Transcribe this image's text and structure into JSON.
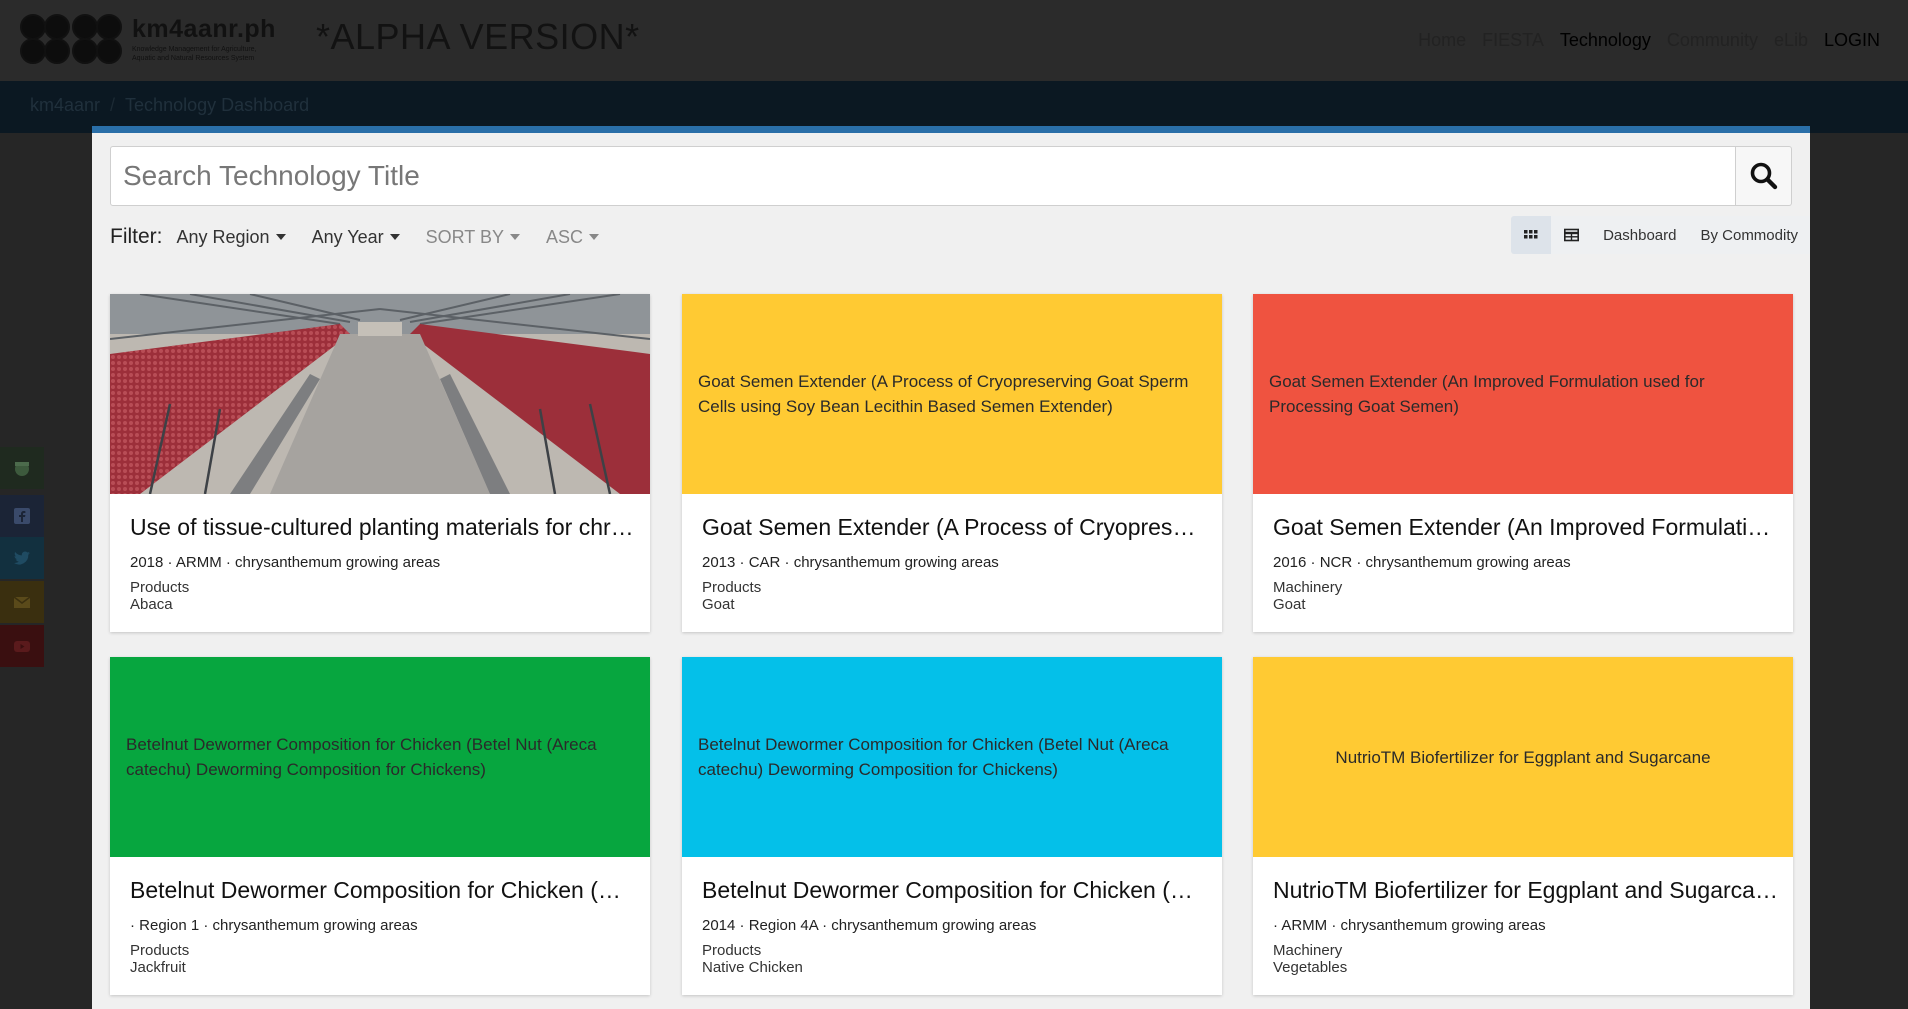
{
  "header": {
    "logo_name": "km4aanr.ph",
    "logo_sub": "Knowledge Management for Agriculture,\nAquatic and Natural Resources System",
    "alpha": "*ALPHA VERSION*",
    "nav": [
      "Home",
      "FIESTA",
      "Technology",
      "Community",
      "eLib",
      "LOGIN"
    ]
  },
  "breadcrumb": {
    "root": "km4aanr",
    "sep": "/",
    "current": "Technology Dashboard"
  },
  "search": {
    "placeholder": "Search Technology Title"
  },
  "filter": {
    "label": "Filter:",
    "region": "Any Region",
    "year": "Any Year",
    "sort": "SORT BY",
    "order": "ASC"
  },
  "views": {
    "dashboard": "Dashboard",
    "commodity": "By Commodity"
  },
  "colors": {
    "yellow": "#ffca33",
    "red": "#ef5340",
    "green": "#07a63f",
    "cyan": "#04c0e9",
    "accent": "#2a6fa8"
  },
  "cards": [
    {
      "cover_text": "",
      "title": "Use of tissue-cultured planting materials for chrysanthemum",
      "meta": "2018 · ARMM · chrysanthemum growing areas",
      "type": "Products",
      "commodity": "Abaca"
    },
    {
      "cover_text": "Goat Semen Extender (A Process of Cryopreserving Goat Sperm Cells using Soy Bean Lecithin Based Semen Extender)",
      "title": "Goat Semen Extender (A Process of Cryopreserving Goat Sperm Cells)",
      "meta": "2013 · CAR · chrysanthemum growing areas",
      "type": "Products",
      "commodity": "Goat"
    },
    {
      "cover_text": "Goat Semen Extender (An Improved Formulation used for Processing Goat Semen)",
      "title": "Goat Semen Extender (An Improved Formulation used for Processing)",
      "meta": "2016 · NCR · chrysanthemum growing areas",
      "type": "Machinery",
      "commodity": "Goat"
    },
    {
      "cover_text": "Betelnut Dewormer Composition for Chicken (Betel Nut (Areca catechu) Deworming Composition for Chickens)",
      "title": "Betelnut Dewormer Composition for Chicken (Betel Nut)",
      "meta": "· Region 1 · chrysanthemum growing areas",
      "type": "Products",
      "commodity": "Jackfruit"
    },
    {
      "cover_text": "Betelnut Dewormer Composition for Chicken (Betel Nut (Areca catechu) Deworming Composition for Chickens)",
      "title": "Betelnut Dewormer Composition for Chicken (Betel Nut)",
      "meta": "2014 · Region 4A · chrysanthemum growing areas",
      "type": "Products",
      "commodity": "Native Chicken"
    },
    {
      "cover_text": "NutrioTM Biofertilizer for Eggplant and Sugarcane",
      "title": "NutrioTM Biofertilizer for Eggplant and Sugarcane",
      "meta": "· ARMM · chrysanthemum growing areas",
      "type": "Machinery",
      "commodity": "Vegetables"
    }
  ]
}
